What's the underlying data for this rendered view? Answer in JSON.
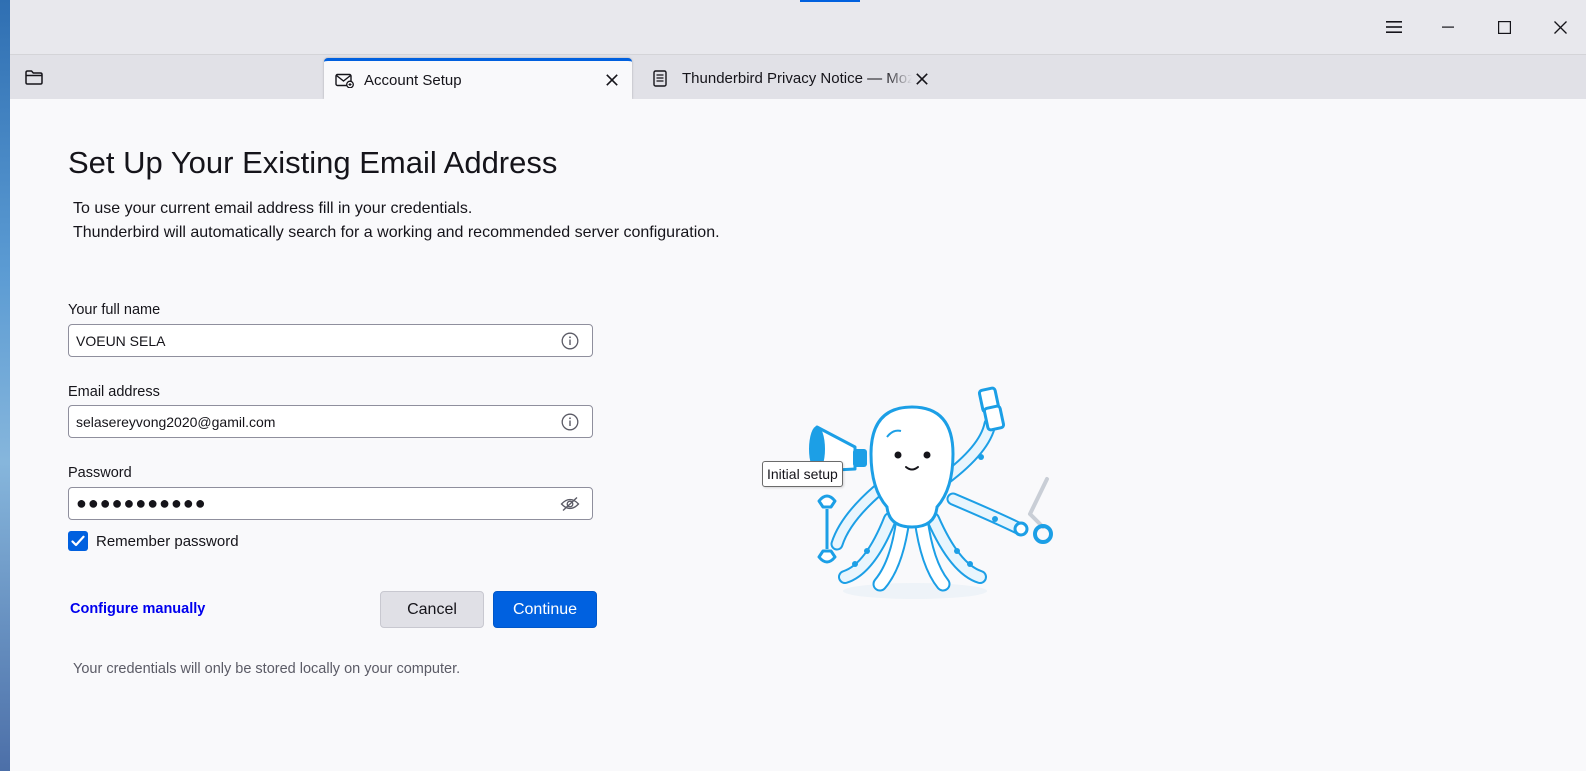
{
  "window": {
    "controls": {
      "menu_icon": "hamburger-menu-icon",
      "minimize_icon": "minimize-icon",
      "maximize_icon": "maximize-icon",
      "close_icon": "close-icon"
    }
  },
  "tabs": [
    {
      "label": "Account Setup",
      "icon": "account-setup-icon",
      "active": true
    },
    {
      "label": "Thunderbird Privacy Notice — Mozilla",
      "icon": "document-icon",
      "active": false
    }
  ],
  "toolbar": {
    "folder_icon": "folder-icon"
  },
  "setup": {
    "title": "Set Up Your Existing Email Address",
    "intro_line1": "To use your current email address fill in your credentials.",
    "intro_line2": "Thunderbird will automatically search for a working and recommended server configuration.",
    "full_name": {
      "label": "Your full name",
      "value": "VOEUN SELA",
      "icon": "info-icon"
    },
    "email": {
      "label": "Email address",
      "value": "selasereyvong2020@gamil.com",
      "icon": "info-icon"
    },
    "password": {
      "label": "Password",
      "value": "●●●●●●●●●●●",
      "icon": "eye-slash-icon"
    },
    "remember_password": {
      "label": "Remember password",
      "checked": true
    },
    "configure_manually": "Configure manually",
    "cancel_label": "Cancel",
    "continue_label": "Continue",
    "footnote": "Your credentials will only be stored locally on your computer."
  },
  "illustration": {
    "tooltip": "Initial setup",
    "icon": "octopus-illustration"
  },
  "colors": {
    "accent": "#0060df",
    "link": "#0000ee",
    "continue_bg": "#0061e0",
    "illustration": "#1c9fe6"
  }
}
